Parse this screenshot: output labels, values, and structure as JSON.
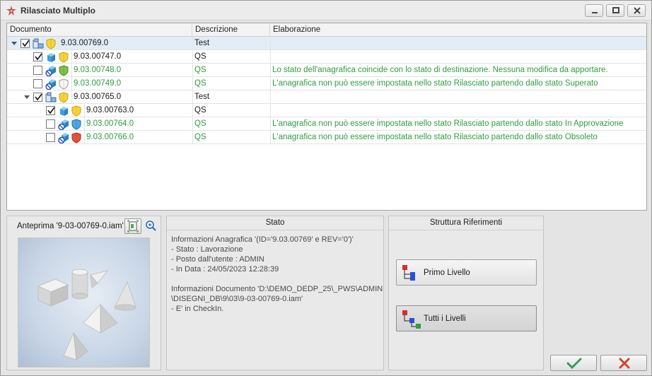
{
  "window": {
    "title": "Rilasciato Multiplo",
    "icon": "star-multicolor-icon"
  },
  "colors": {
    "ok_text": "#2e9e3e",
    "selected_row": "#e2edf7",
    "confirm_icon": "#3c9a5a",
    "cancel_icon": "#d9412f"
  },
  "grid": {
    "columns": [
      "Documento",
      "Descrizione",
      "Elaborazione"
    ],
    "rows": [
      {
        "code": "9.03.00769.0",
        "descr": "Test",
        "elab": "",
        "level": 0,
        "expandable": true,
        "checked": true,
        "type": "assembly",
        "shield": "yellow",
        "green": false,
        "selected": true
      },
      {
        "code": "9.03.00747.0",
        "descr": "QS",
        "elab": "",
        "level": 1,
        "expandable": false,
        "checked": true,
        "type": "part",
        "shield": "yellow",
        "green": false,
        "selected": false
      },
      {
        "code": "9.03.00748.0",
        "descr": "QS",
        "elab": "Lo stato dell'anagrafica coincide con lo stato di destinazione. Nessuna modifica da apportare.",
        "level": 1,
        "expandable": false,
        "checked": false,
        "type": "part-blocked",
        "shield": "green",
        "green": true,
        "selected": false
      },
      {
        "code": "9.03.00749.0",
        "descr": "QS",
        "elab": "L'anagrafica non può essere impostata nello stato Rilasciato partendo dallo stato Superato",
        "level": 1,
        "expandable": false,
        "checked": false,
        "type": "part-blocked",
        "shield": "white",
        "green": true,
        "selected": false
      },
      {
        "code": "9.03.00765.0",
        "descr": "Test",
        "elab": "",
        "level": 1,
        "expandable": true,
        "checked": true,
        "type": "assembly",
        "shield": "yellow",
        "green": false,
        "selected": false
      },
      {
        "code": "9.03.00763.0",
        "descr": "QS",
        "elab": "",
        "level": 2,
        "expandable": false,
        "checked": true,
        "type": "part",
        "shield": "yellow",
        "green": false,
        "selected": false
      },
      {
        "code": "9.03.00764.0",
        "descr": "QS",
        "elab": "L'anagrafica non può essere impostata nello stato Rilasciato partendo dallo stato In Approvazione",
        "level": 2,
        "expandable": false,
        "checked": false,
        "type": "part-blocked",
        "shield": "blue",
        "green": true,
        "selected": false
      },
      {
        "code": "9.03.00766.0",
        "descr": "QS",
        "elab": "L'anagrafica non può essere impostata nello stato Rilasciato partendo dallo stato Obsoleto",
        "level": 2,
        "expandable": false,
        "checked": false,
        "type": "part-blocked",
        "shield": "red",
        "green": true,
        "selected": false
      }
    ]
  },
  "preview": {
    "label": "Anteprima '9-03-00769-0.iam'",
    "tool_fit_icon": "fit-view-icon",
    "tool_zoom_icon": "zoom-icon"
  },
  "stato": {
    "title": "Stato",
    "text": "Informazioni Anagrafica '(ID='9.03.00769' e REV='0')'\n- Stato : Lavorazione\n- Posto dall'utente : ADMIN\n- In Data : 24/05/2023 12:28:39\n\nInformazioni Documento 'D:\\DEMO_DEDP_25\\_PWS\\ADMIN\n\\DISEGNI_DB\\9\\03\\9-03-00769-0.iam'\n- E' in CheckIn."
  },
  "struttura": {
    "title": "Struttura Riferimenti",
    "primo_livello": "Primo Livello",
    "tutti_livelli": "Tutti i Livelli"
  },
  "actions": {
    "confirm_icon": "check-icon",
    "cancel_icon": "x-icon"
  }
}
